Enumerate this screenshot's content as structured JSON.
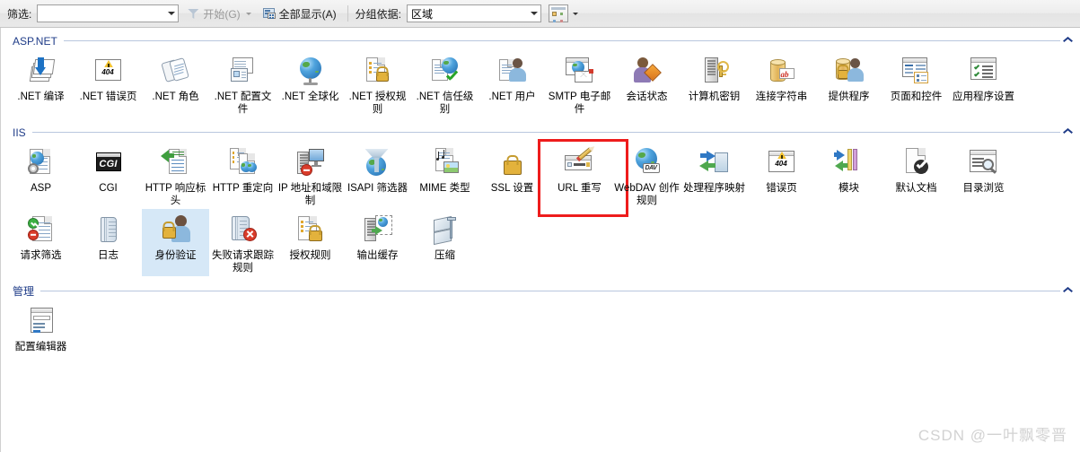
{
  "toolbar": {
    "filter_label": "筛选:",
    "filter_value": "",
    "filter_placeholder": "",
    "start_label": "开始(G)",
    "show_all_label": "全部显示(A)",
    "group_by_label": "分组依据:",
    "group_by_value": "区域",
    "view_button_name": "视图"
  },
  "sections": [
    {
      "title": "ASP.NET",
      "items": [
        {
          "label": ".NET 编译",
          "icon": "dotnet-compilation-icon"
        },
        {
          "label": ".NET 错误页",
          "icon": "dotnet-error-pages-icon"
        },
        {
          "label": ".NET 角色",
          "icon": "dotnet-roles-icon"
        },
        {
          "label": ".NET 配置文件",
          "icon": "dotnet-profile-icon"
        },
        {
          "label": ".NET 全球化",
          "icon": "dotnet-globalization-icon"
        },
        {
          "label": ".NET 授权规则",
          "icon": "dotnet-authorization-rules-icon"
        },
        {
          "label": ".NET 信任级别",
          "icon": "dotnet-trust-levels-icon"
        },
        {
          "label": ".NET 用户",
          "icon": "dotnet-users-icon"
        },
        {
          "label": "SMTP 电子邮件",
          "icon": "smtp-email-icon"
        },
        {
          "label": "会话状态",
          "icon": "session-state-icon"
        },
        {
          "label": "计算机密钥",
          "icon": "machine-key-icon"
        },
        {
          "label": "连接字符串",
          "icon": "connection-strings-icon"
        },
        {
          "label": "提供程序",
          "icon": "providers-icon"
        },
        {
          "label": "页面和控件",
          "icon": "pages-and-controls-icon"
        },
        {
          "label": "应用程序设置",
          "icon": "application-settings-icon"
        }
      ]
    },
    {
      "title": "IIS",
      "items": [
        {
          "label": "ASP",
          "icon": "asp-icon"
        },
        {
          "label": "CGI",
          "icon": "cgi-icon"
        },
        {
          "label": "HTTP 响应标头",
          "icon": "http-response-headers-icon"
        },
        {
          "label": "HTTP 重定向",
          "icon": "http-redirect-icon"
        },
        {
          "label": "IP 地址和域限制",
          "icon": "ip-address-domain-restrictions-icon"
        },
        {
          "label": "ISAPI 筛选器",
          "icon": "isapi-filters-icon"
        },
        {
          "label": "MIME 类型",
          "icon": "mime-types-icon"
        },
        {
          "label": "SSL 设置",
          "icon": "ssl-settings-icon"
        },
        {
          "label": "URL 重写",
          "icon": "url-rewrite-icon",
          "highlighted": true
        },
        {
          "label": "WebDAV 创作规则",
          "icon": "webdav-authoring-rules-icon"
        },
        {
          "label": "处理程序映射",
          "icon": "handler-mappings-icon"
        },
        {
          "label": "错误页",
          "icon": "error-pages-icon"
        },
        {
          "label": "模块",
          "icon": "modules-icon"
        },
        {
          "label": "默认文档",
          "icon": "default-document-icon"
        },
        {
          "label": "目录浏览",
          "icon": "directory-browsing-icon"
        },
        {
          "label": "请求筛选",
          "icon": "request-filtering-icon"
        },
        {
          "label": "日志",
          "icon": "logging-icon"
        },
        {
          "label": "身份验证",
          "icon": "authentication-icon",
          "selected": true
        },
        {
          "label": "失败请求跟踪规则",
          "icon": "failed-request-tracing-rules-icon"
        },
        {
          "label": "授权规则",
          "icon": "authorization-rules-icon"
        },
        {
          "label": "输出缓存",
          "icon": "output-caching-icon"
        },
        {
          "label": "压缩",
          "icon": "compression-icon"
        }
      ]
    },
    {
      "title": "管理",
      "items": [
        {
          "label": "配置编辑器",
          "icon": "configuration-editor-icon"
        }
      ]
    }
  ],
  "watermark": "CSDN @一叶飘零晋",
  "colors": {
    "section_title": "#1f3c88",
    "selection": "#d6e8f7",
    "highlight_box": "#ee1c1c"
  }
}
